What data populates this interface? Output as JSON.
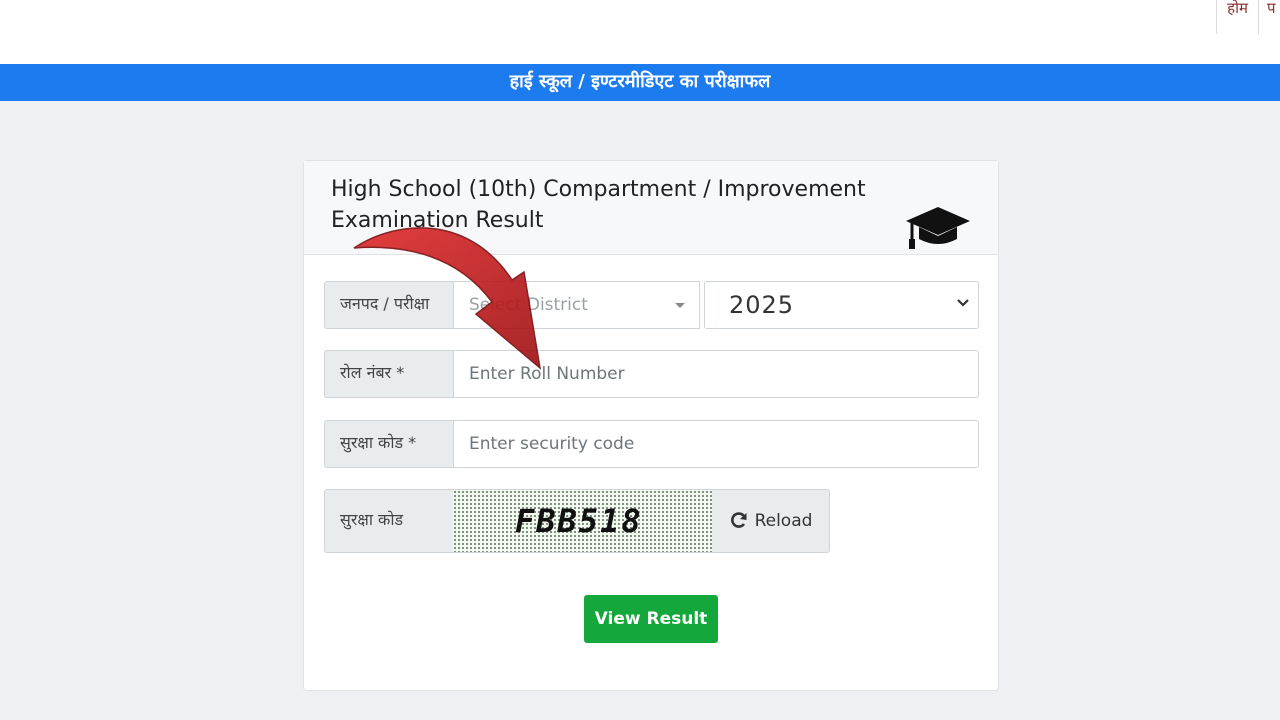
{
  "top_nav": {
    "items": [
      "होम",
      "प"
    ]
  },
  "banner": {
    "title": "हाई स्कूल / इण्टरमीडिएट का परीक्षाफल"
  },
  "card": {
    "title": "High School (10th) Compartment / Improvement Examination Result"
  },
  "form": {
    "district_label": "जनपद / परीक्षा",
    "district_placeholder": "Select District",
    "year_value": "2025",
    "roll_label": "रोल नंबर *",
    "roll_placeholder": "Enter Roll Number",
    "security_label": "सुरक्षा कोड *",
    "security_placeholder": "Enter security code",
    "captcha_label": "सुरक्षा कोड",
    "captcha_text": "FBB518",
    "reload_label": "Reload",
    "submit_label": "View Result"
  },
  "icons": {
    "header": "graduation-cap-icon",
    "reload": "refresh-icon",
    "overlay": "curved-arrow-icon"
  },
  "colors": {
    "banner": "#1d7bf0",
    "submit": "#14a83c",
    "arrow": "#c0181b"
  }
}
